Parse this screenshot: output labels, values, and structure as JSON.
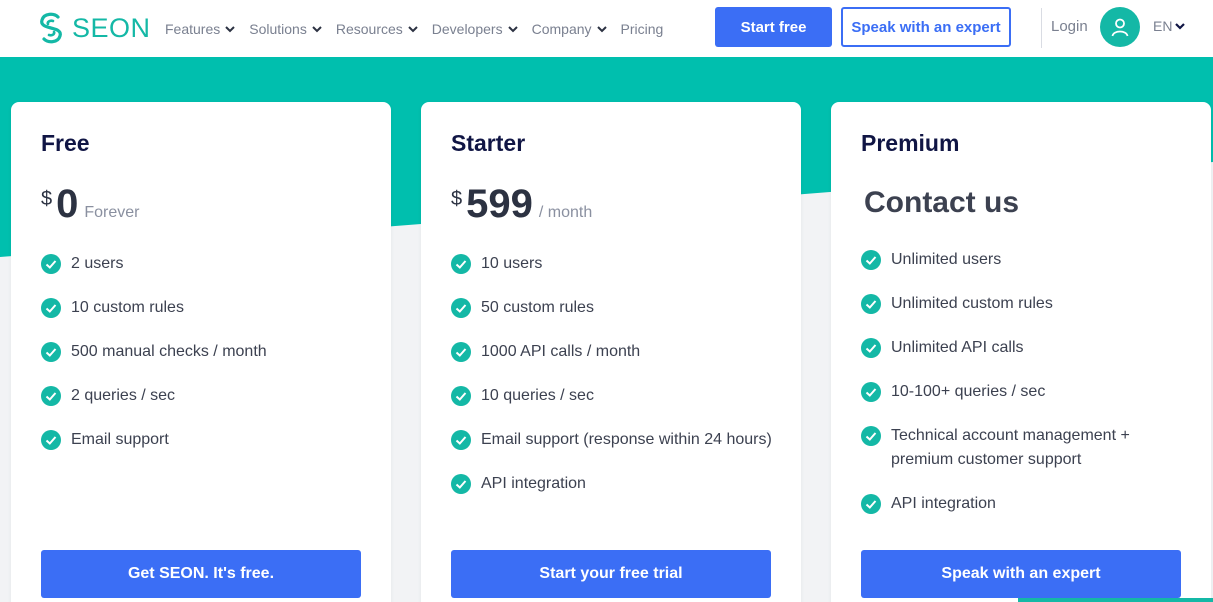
{
  "colors": {
    "teal": "#14b8a6",
    "blue": "#3b6ef5",
    "navy": "#101544"
  },
  "nav": {
    "logo_text": "SEON",
    "menu": [
      "Features",
      "Solutions",
      "Resources",
      "Developers",
      "Company",
      "Pricing"
    ],
    "start_free": "Start free",
    "speak_expert": "Speak with an expert",
    "login": "Login",
    "lang": "EN"
  },
  "plans": {
    "free": {
      "name": "Free",
      "currency": "$",
      "amount": "0",
      "period": "Forever",
      "features": [
        "2 users",
        "10 custom rules",
        "500 manual checks / month",
        "2 queries / sec",
        "Email support"
      ],
      "cta": "Get SEON. It's free."
    },
    "starter": {
      "name": "Starter",
      "currency": "$",
      "amount": "599",
      "period": "/ month",
      "features": [
        "10 users",
        "50 custom rules",
        "1000 API calls / month",
        "10 queries / sec",
        "Email support (response within 24 hours)",
        "API integration"
      ],
      "cta": "Start your free trial"
    },
    "premium": {
      "name": "Premium",
      "contact": "Contact us",
      "features": [
        "Unlimited users",
        "Unlimited custom rules",
        "Unlimited API calls",
        "10-100+ queries / sec",
        "Technical account management + premium customer support",
        "API integration"
      ],
      "cta": "Speak with an expert"
    }
  }
}
